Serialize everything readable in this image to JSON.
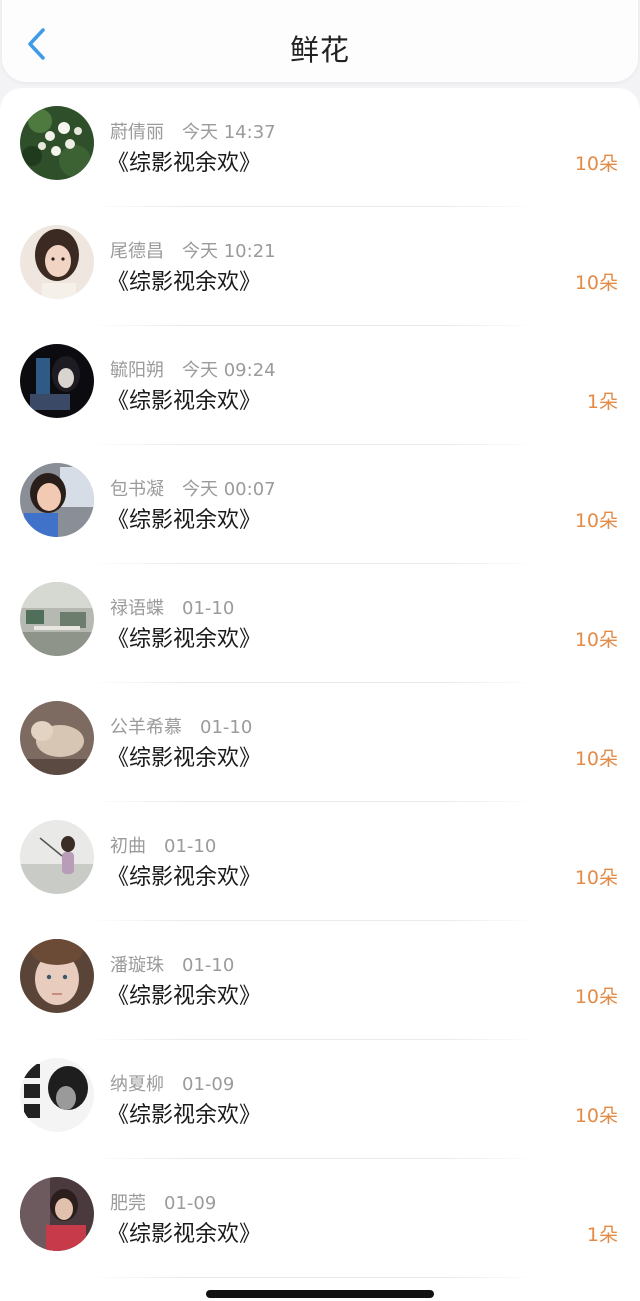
{
  "header": {
    "title": "鲜花",
    "back_icon": "chevron-left-icon",
    "accent_color": "#3d9be9"
  },
  "count_color": "#e38b47",
  "rows": [
    {
      "name": "蔚倩丽",
      "time": "今天 14:37",
      "work": "《综影视余欢》",
      "count": "10朵"
    },
    {
      "name": "尾德昌",
      "time": "今天 10:21",
      "work": "《综影视余欢》",
      "count": "10朵"
    },
    {
      "name": "毓阳朔",
      "time": "今天 09:24",
      "work": "《综影视余欢》",
      "count": "1朵"
    },
    {
      "name": "包书凝",
      "time": "今天 00:07",
      "work": "《综影视余欢》",
      "count": "10朵"
    },
    {
      "name": "禄语蝶",
      "time": "01-10",
      "work": "《综影视余欢》",
      "count": "10朵"
    },
    {
      "name": "公羊希慕",
      "time": "01-10",
      "work": "《综影视余欢》",
      "count": "10朵"
    },
    {
      "name": "初曲",
      "time": "01-10",
      "work": "《综影视余欢》",
      "count": "10朵"
    },
    {
      "name": "潘璇珠",
      "time": "01-10",
      "work": "《综影视余欢》",
      "count": "10朵"
    },
    {
      "name": "纳夏柳",
      "time": "01-09",
      "work": "《综影视余欢》",
      "count": "10朵"
    },
    {
      "name": "肥莞",
      "time": "01-09",
      "work": "《综影视余欢》",
      "count": "1朵"
    }
  ]
}
